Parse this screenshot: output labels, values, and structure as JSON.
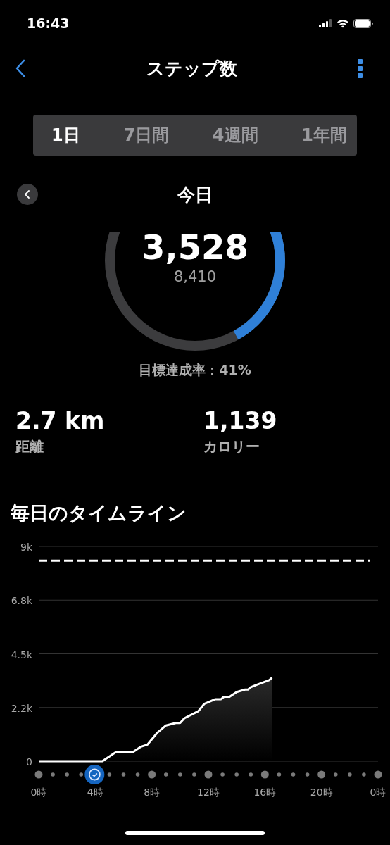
{
  "status_bar": {
    "time": "16:43"
  },
  "nav": {
    "title": "ステップ数"
  },
  "tabs": [
    {
      "label": "1日",
      "selected": true
    },
    {
      "label": "7日間",
      "selected": false
    },
    {
      "label": "4週間",
      "selected": false
    },
    {
      "label": "1年間",
      "selected": false
    }
  ],
  "period": {
    "title": "今日"
  },
  "ring": {
    "steps": "3,528",
    "goal": "8,410",
    "achievement": "目標達成率：41%"
  },
  "stats": [
    {
      "value": "2.7 km",
      "label": "距離"
    },
    {
      "value": "1,139",
      "label": "カロリー"
    }
  ],
  "timeline": {
    "title": "毎日のタイムライン",
    "axis_end_label": "0時",
    "chart_data": {
      "type": "area",
      "x": [
        0,
        4.5,
        5.5,
        6.7,
        7.2,
        7.7,
        8.4,
        9.0,
        9.7,
        10.0,
        10.3,
        11.3,
        11.7,
        12.5,
        12.9,
        13.1,
        13.5,
        14.0,
        14.6,
        14.8,
        15.0,
        15.4,
        16.3,
        16.5,
        23.4
      ],
      "series": [
        {
          "color": "#ffffff",
          "values": [
            0,
            0,
            400,
            400,
            600,
            700,
            1200,
            1500,
            1600,
            1600,
            1800,
            2100,
            2400,
            2600,
            2600,
            2700,
            2700,
            2900,
            3000,
            3000,
            3100,
            3200,
            3400,
            3500,
            null
          ]
        },
        {
          "type": "line",
          "line_style": "dashed",
          "color": "#ffffff",
          "values": [
            8400,
            8400,
            8400,
            8400,
            8400,
            8400,
            8400,
            8400,
            8400,
            8400,
            8400,
            8400,
            8400,
            8400,
            8400,
            8400,
            8400,
            8400,
            8400,
            8400,
            8400,
            8400,
            8400,
            8400,
            8400
          ]
        }
      ],
      "grid": true,
      "xlim": [
        0,
        24
      ],
      "ylim": [
        0,
        9000
      ],
      "xticks": [
        {
          "value": 0,
          "label": "0時"
        },
        {
          "value": 4,
          "label": "4時"
        },
        {
          "value": 8,
          "label": "8時"
        },
        {
          "value": 12,
          "label": "12時"
        },
        {
          "value": 16,
          "label": "16時"
        },
        {
          "value": 20,
          "label": "20時"
        }
      ],
      "yticks": [
        {
          "value": 0,
          "label": "0"
        },
        {
          "value": 2250,
          "label": "2.2k"
        },
        {
          "value": 4500,
          "label": "4.5k"
        },
        {
          "value": 6750,
          "label": "6.8k"
        },
        {
          "value": 9000,
          "label": "9k"
        }
      ]
    }
  }
}
